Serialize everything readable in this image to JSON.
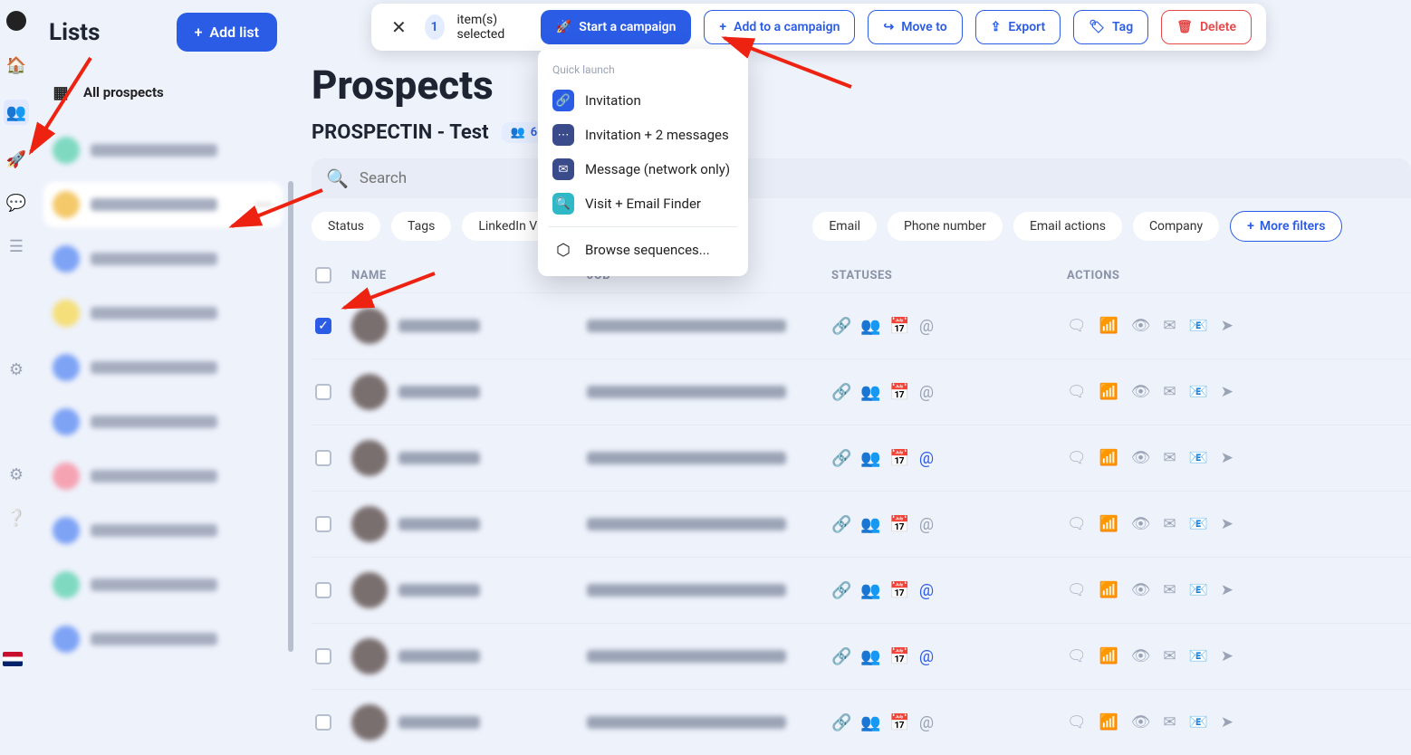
{
  "sidebar": {
    "title": "Lists",
    "add_list": "Add list",
    "all_prospects": "All prospects",
    "items": [
      {
        "color": "#7fd9c1"
      },
      {
        "color": "#f4c96a",
        "selected": true
      },
      {
        "color": "#7ea3f5"
      },
      {
        "color": "#f5df7a"
      },
      {
        "color": "#7ea3f5"
      },
      {
        "color": "#7ea3f5"
      },
      {
        "color": "#f5a3b3"
      },
      {
        "color": "#7ea3f5"
      },
      {
        "color": "#7fd9c1"
      },
      {
        "color": "#7ea3f5"
      }
    ]
  },
  "action_bar": {
    "count": "1",
    "selected_text": "item(s) selected",
    "start": "Start a campaign",
    "add": "Add to a campaign",
    "move": "Move to",
    "export": "Export",
    "tag": "Tag",
    "delete": "Delete"
  },
  "page": {
    "title": "Prospects",
    "subtitle": "PROSPECTIN - Test",
    "badge_count": "6"
  },
  "search": {
    "placeholder": "Search"
  },
  "filters": {
    "status": "Status",
    "tags": "Tags",
    "linkedin": "LinkedIn Visit/F",
    "email": "Email",
    "phone": "Phone number",
    "emailactions": "Email actions",
    "company": "Company",
    "more": "More filters"
  },
  "table": {
    "head": {
      "name": "NAME",
      "job": "JOB",
      "statuses": "STATUSES",
      "actions": "ACTIONS"
    },
    "rows": [
      {
        "checked": true,
        "status_blue": false
      },
      {
        "checked": false,
        "status_blue": false
      },
      {
        "checked": false,
        "status_blue": true
      },
      {
        "checked": false,
        "status_blue": false
      },
      {
        "checked": false,
        "status_blue": true
      },
      {
        "checked": false,
        "status_blue": true
      },
      {
        "checked": false,
        "status_blue": false
      }
    ]
  },
  "dropdown": {
    "head": "Quick launch",
    "items": [
      {
        "label": "Invitation"
      },
      {
        "label": "Invitation + 2 messages"
      },
      {
        "label": "Message (network only)"
      },
      {
        "label": "Visit + Email Finder"
      }
    ],
    "browse": "Browse sequences..."
  }
}
